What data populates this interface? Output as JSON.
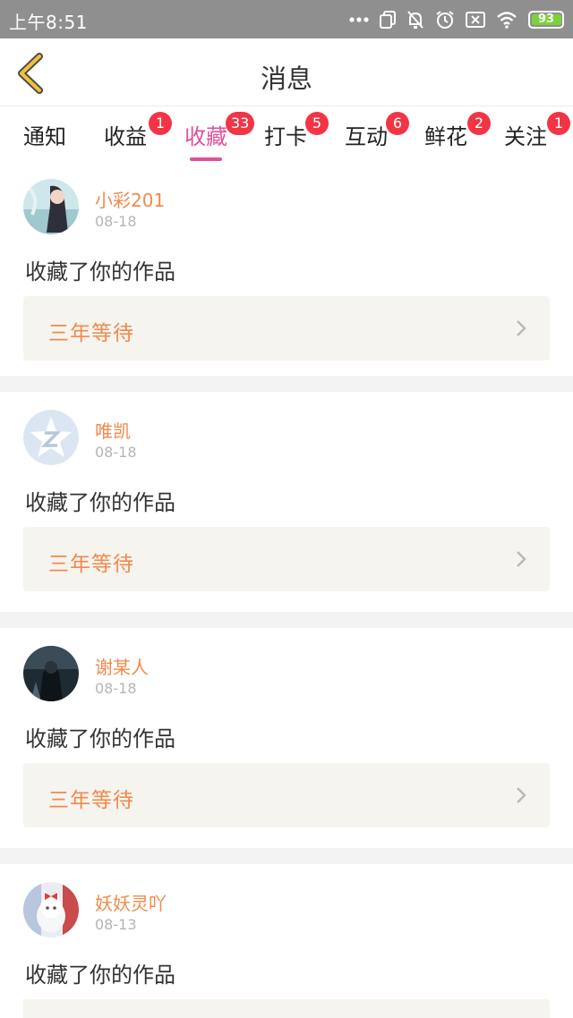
{
  "status_bar": {
    "time": "上午8:51",
    "battery": "93",
    "icons": [
      "more-dots-icon",
      "sim-icon",
      "bell-off-icon",
      "alarm-icon",
      "close-box-icon",
      "wifi-icon",
      "battery-icon"
    ]
  },
  "header": {
    "back_icon": "chevron-left-icon",
    "title": "消息"
  },
  "tabs": [
    {
      "label": "通知",
      "badge": ""
    },
    {
      "label": "收益",
      "badge": "1"
    },
    {
      "label": "收藏",
      "badge": "33",
      "active": true
    },
    {
      "label": "打卡",
      "badge": "5"
    },
    {
      "label": "互动",
      "badge": "6"
    },
    {
      "label": "鲜花",
      "badge": "2"
    },
    {
      "label": "关注",
      "badge": "1"
    }
  ],
  "messages": [
    {
      "user": "小彩201",
      "date": "08-18",
      "action": "收藏了你的作品",
      "work": "三年等待"
    },
    {
      "user": "唯凯",
      "date": "08-18",
      "action": "收藏了你的作品",
      "work": "三年等待"
    },
    {
      "user": "谢某人",
      "date": "08-18",
      "action": "收藏了你的作品",
      "work": "三年等待"
    },
    {
      "user": "妖妖灵吖",
      "date": "08-13",
      "action": "收藏了你的作品",
      "work": ""
    }
  ],
  "colors": {
    "accent_pink": "#e14f9a",
    "badge_red": "#f23545",
    "name_orange": "#f08a4b",
    "card_bg": "#f5f4ef"
  }
}
